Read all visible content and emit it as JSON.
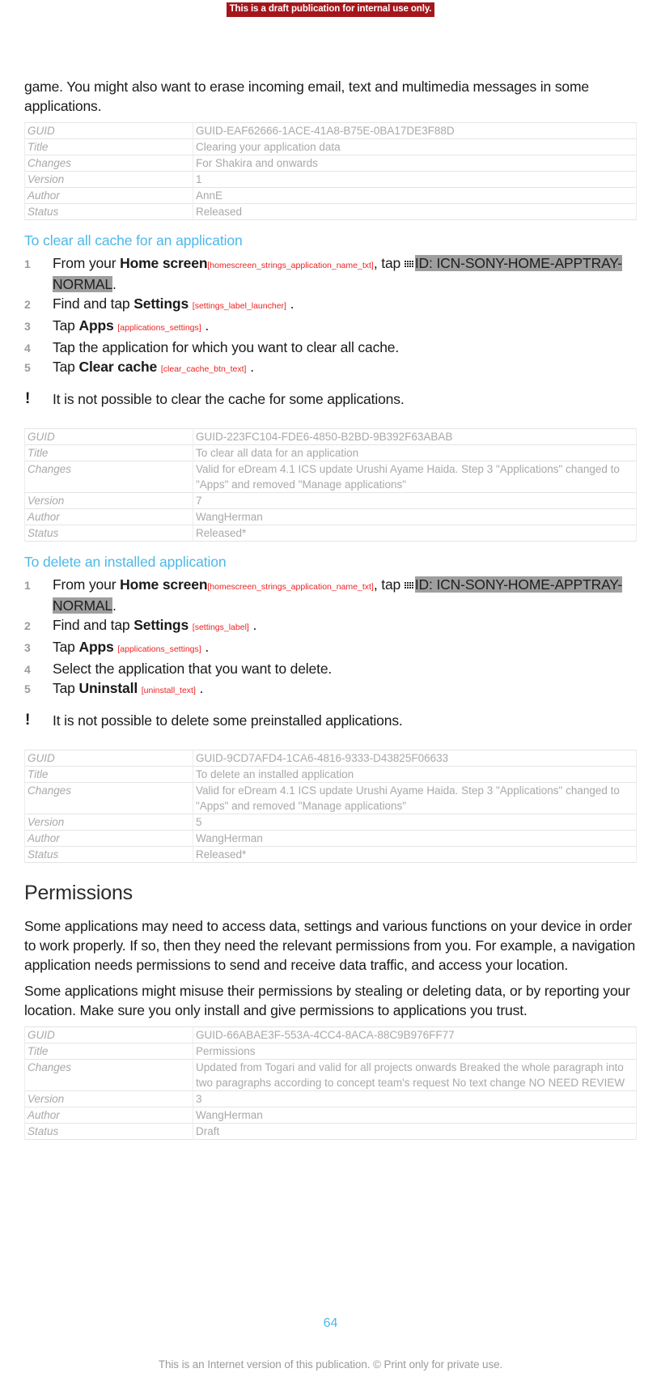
{
  "banner": {
    "text": "This is a draft publication for internal use only."
  },
  "intro": {
    "paragraph": "game. You might also want to erase incoming email, text and multimedia messages in some applications."
  },
  "meta_labels": {
    "guid": "GUID",
    "title": "Title",
    "changes": "Changes",
    "version": "Version",
    "author": "Author",
    "status": "Status"
  },
  "tables": [
    {
      "guid": "GUID-EAF62666-1ACE-41A8-B75E-0BA17DE3F88D",
      "title": "Clearing your application data",
      "changes": "For Shakira and onwards",
      "version": "1",
      "author": "AnnE",
      "status": "Released"
    },
    {
      "guid": "GUID-223FC104-FDE6-4850-B2BD-9B392F63ABAB",
      "title": "To clear all data for an application",
      "changes": "Valid for eDream 4.1 ICS update Urushi Ayame Haida. Step 3 \"Applications\" changed to \"Apps\" and removed \"Manage applications\"",
      "version": "7",
      "author": "WangHerman",
      "status": "Released*"
    },
    {
      "guid": "GUID-9CD7AFD4-1CA6-4816-9333-D43825F06633",
      "title": "To delete an installed application",
      "changes": "Valid for eDream 4.1 ICS update Urushi Ayame Haida. Step 3 \"Applications\" changed to \"Apps\" and removed \"Manage applications\"",
      "version": "5",
      "author": "WangHerman",
      "status": "Released*"
    },
    {
      "guid": "GUID-66ABAE3F-553A-4CC4-8ACA-88C9B976FF77",
      "title": "Permissions",
      "changes": "Updated from Togari and valid for all projects onwards Breaked the whole paragraph into two paragraphs according to concept team's request No text change NO NEED REVIEW",
      "version": "3",
      "author": "WangHerman",
      "status": "Draft"
    }
  ],
  "procedures": [
    {
      "heading": "To clear all cache for an application",
      "steps": [
        {
          "prefix": "From your ",
          "term": "Home screen",
          "string_id": "[homescreen_strings_application_name_txt]",
          "middle": ", tap ",
          "icon": "apptray-grid-icon",
          "highlight": "ID: ICN-SONY-HOME-APPTRAY-NORMAL",
          "suffix": "."
        },
        {
          "prefix": "Find and tap ",
          "term": "Settings",
          "string_id": "[settings_label_launcher]",
          "suffix": "."
        },
        {
          "prefix": "Tap ",
          "term": "Apps",
          "string_id": "[applications_settings]",
          "suffix": "."
        },
        {
          "prefix": "Tap the application for which you want to clear all cache.",
          "term": "",
          "string_id": "",
          "suffix": ""
        },
        {
          "prefix": "Tap ",
          "term": "Clear cache",
          "string_id": "[clear_cache_btn_text]",
          "suffix": "."
        }
      ],
      "note": "It is not possible to clear the cache for some applications."
    },
    {
      "heading": "To delete an installed application",
      "steps": [
        {
          "prefix": "From your ",
          "term": "Home screen",
          "string_id": "[homescreen_strings_application_name_txt]",
          "middle": ", tap ",
          "icon": "apptray-grid-icon",
          "highlight": "ID: ICN-SONY-HOME-APPTRAY-NORMAL",
          "suffix": "."
        },
        {
          "prefix": "Find and tap ",
          "term": "Settings",
          "string_id": "[settings_label]",
          "suffix": "."
        },
        {
          "prefix": "Tap ",
          "term": "Apps",
          "string_id": "[applications_settings]",
          "suffix": "."
        },
        {
          "prefix": "Select the application that you want to delete.",
          "term": "",
          "string_id": "",
          "suffix": ""
        },
        {
          "prefix": "Tap ",
          "term": "Uninstall",
          "string_id": "[uninstall_text]",
          "suffix": "."
        }
      ],
      "note": "It is not possible to delete some preinstalled applications."
    }
  ],
  "permissions": {
    "heading": "Permissions",
    "paragraph1": "Some applications may need to access data, settings and various functions on your device in order to work properly. If so, then they need the relevant permissions from you. For example, a navigation application needs permissions to send and receive data traffic, and access your location.",
    "paragraph2": "Some applications might misuse their permissions by stealing or deleting data, or by reporting your location. Make sure you only install and give permissions to applications you trust."
  },
  "footer": {
    "page_number": "64",
    "note": "This is an Internet version of this publication. © Print only for private use."
  },
  "colors": {
    "banner_bg": "#a5161b",
    "accent_blue": "#4cb8e8",
    "string_id_red": "#ee2222",
    "highlight_gray": "#9e9e9e",
    "meta_text": "#a9a9a9"
  }
}
